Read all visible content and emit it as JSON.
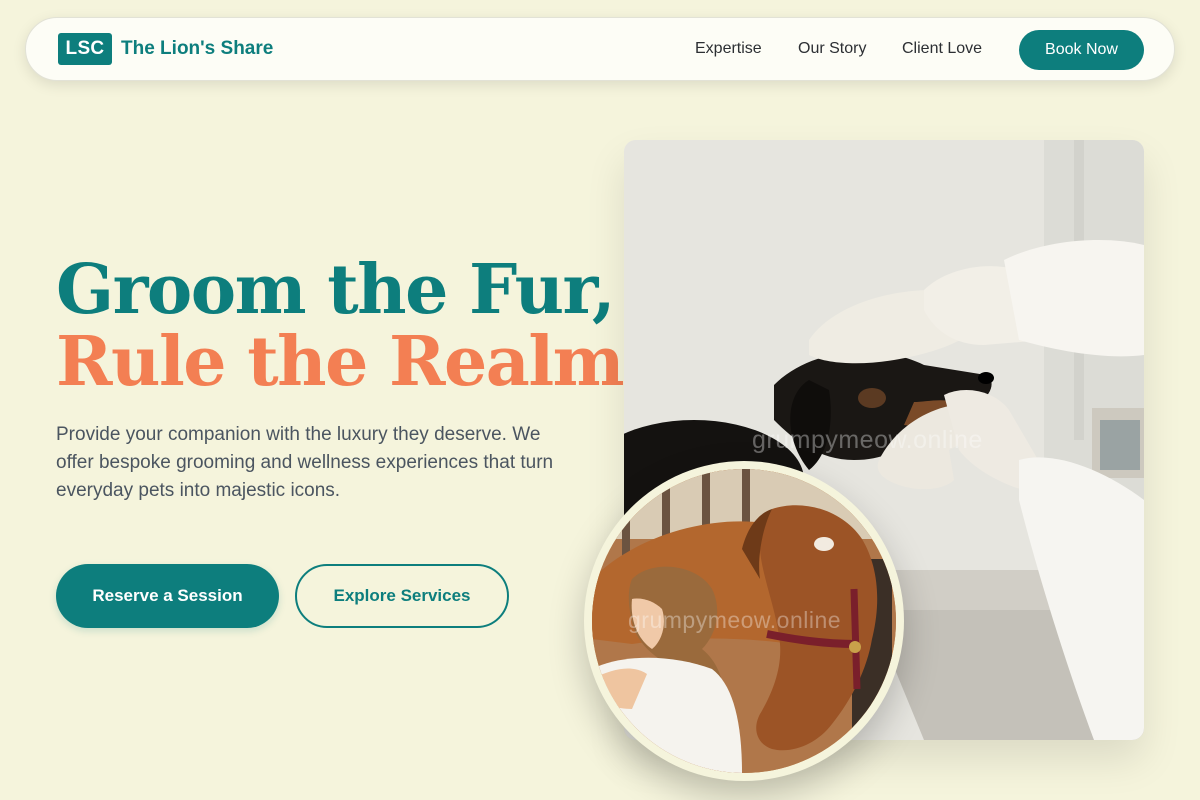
{
  "nav": {
    "logo_mark": "LSC",
    "brand_name": "The Lion's Share",
    "links": [
      "Expertise",
      "Our Story",
      "Client Love"
    ],
    "cta_label": "Book Now"
  },
  "hero": {
    "title_line_1": "Groom the Fur,",
    "title_line_2": "Rule the Realm.",
    "description": "Provide your companion with the luxury they deserve. We offer bespoke grooming and wellness experiences that turn everyday pets into majestic icons.",
    "primary_button": "Reserve a Session",
    "secondary_button": "Explore Services"
  },
  "images": {
    "main_photo": "dog-examination-photo",
    "circle_photo": "horse-grooming-photo",
    "watermark": "grumpymeow.online"
  },
  "colors": {
    "background": "#f5f4dc",
    "brand_teal": "#0d7e7d",
    "accent_coral": "#f37f53",
    "text_body": "#4b5560"
  }
}
